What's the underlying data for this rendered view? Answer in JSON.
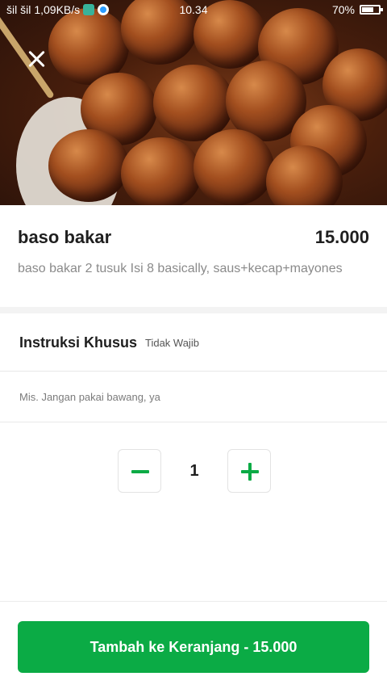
{
  "status_bar": {
    "signal": "šil šil",
    "speed": "1,09KB/s",
    "time": "10.34",
    "battery": "70%",
    "battery_level": 0.7
  },
  "hero": {
    "image": "grilled-meatball-skewers"
  },
  "item": {
    "name": "baso bakar",
    "price": "15.000",
    "description": "baso bakar 2 tusuk Isi 8 basically, saus+kecap+mayones"
  },
  "instructions": {
    "title": "Instruksi Khusus",
    "optional_label": "Tidak Wajib",
    "placeholder": "Mis. Jangan pakai bawang, ya",
    "value": ""
  },
  "quantity": {
    "value": "1",
    "minus_icon": "minus-icon",
    "plus_icon": "plus-icon"
  },
  "cta": {
    "label": "Tambah ke Keranjang - 15.000"
  },
  "colors": {
    "accent": "#0bab45",
    "muted_text": "#8a8a8a"
  }
}
